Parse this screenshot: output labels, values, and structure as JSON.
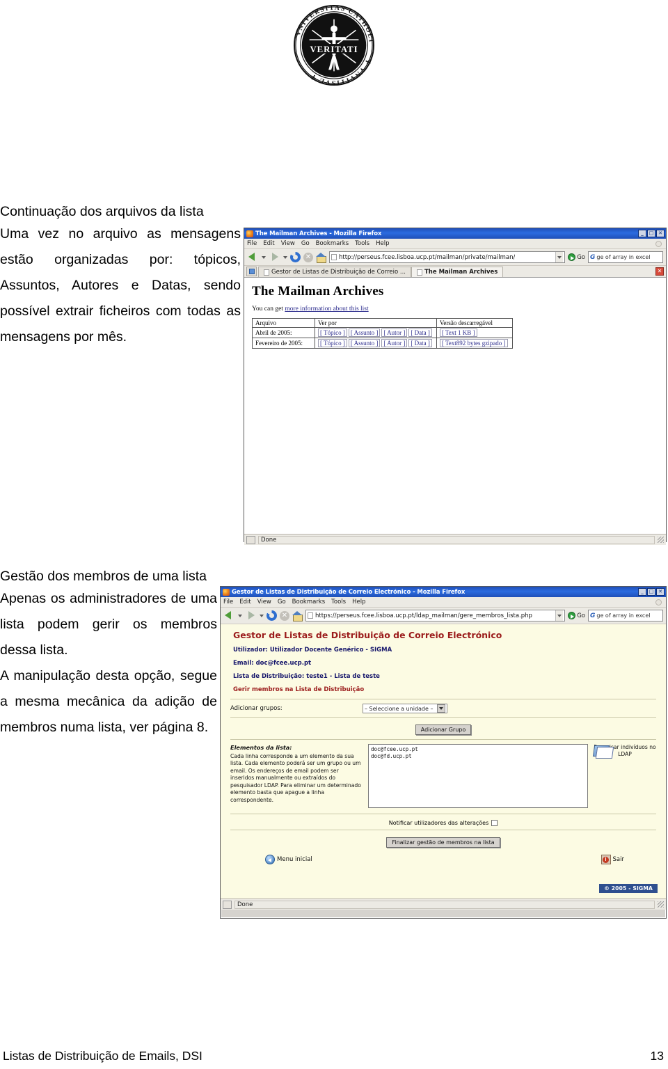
{
  "page": {
    "logo_alt": "university-seal",
    "seal_outer_text": "VNIVERSITAS CATHOLICA LVSITANA",
    "seal_inner_text": "VERITATI",
    "footer_left": "Listas de Distribuição de Emails, DSI",
    "footer_page_number": "13"
  },
  "section1": {
    "heading": "Continuação dos arquivos da lista",
    "paragraph": "Uma vez no arquivo as mensagens estão organizadas por: tópicos, Assuntos, Autores e Datas, sendo possível extrair ficheiros com todas as mensagens por mês."
  },
  "section2": {
    "heading": "Gestão dos membros de uma lista",
    "paragraph1": "Apenas os administradores de uma lista podem gerir os membros dessa lista.",
    "paragraph2": "A manipulação desta opção, segue a mesma mecânica da adição de membros numa lista, ver página 8."
  },
  "window1": {
    "title": "The Mailman Archives - Mozilla Firefox",
    "window_buttons": [
      "_",
      "□",
      "✕"
    ],
    "menus": [
      "File",
      "Edit",
      "View",
      "Go",
      "Bookmarks",
      "Tools",
      "Help"
    ],
    "url": "http://perseus.fcee.lisboa.ucp.pt/mailman/private/mailman/",
    "go_label": "Go",
    "search_placeholder": "ge of array in excel",
    "search_engine_glyph": "G",
    "tabs": [
      {
        "label": "Gestor de Listas de Distribuição de Correio ...",
        "active": false
      },
      {
        "label": "The Mailman Archives",
        "active": true
      }
    ],
    "page": {
      "title": "The Mailman Archives",
      "info_prefix": "You can get ",
      "info_link": "more information about this list",
      "table": {
        "headers": [
          "Arquivo",
          "Ver por",
          "Versão descarregável"
        ],
        "rows": [
          {
            "arquivo": "Abril de 2005:",
            "views": [
              "[ Tópico ]",
              "[ Assunto ]",
              "[ Autor ]",
              "[ Data ]"
            ],
            "download": "[ Text 1 KB ]"
          },
          {
            "arquivo": "Fevereiro de 2005:",
            "views": [
              "[ Tópico ]",
              "[ Assunto ]",
              "[ Autor ]",
              "[ Data ]"
            ],
            "download": "[ Text892 bytes gzipado ]"
          }
        ]
      }
    },
    "status": "Done"
  },
  "window2": {
    "title": "Gestor de Listas de Distribuição de Correio Electrónico - Mozilla Firefox",
    "window_buttons": [
      "_",
      "□",
      "✕"
    ],
    "menus": [
      "File",
      "Edit",
      "View",
      "Go",
      "Bookmarks",
      "Tools",
      "Help"
    ],
    "url": "https://perseus.fcee.lisboa.ucp.pt/ldap_mailman/gere_membros_lista.php",
    "go_label": "Go",
    "search_placeholder": "ge of array in excel",
    "search_engine_glyph": "G",
    "page": {
      "app_title": "Gestor de Listas de Distribuição de Correio Electrónico",
      "user_line": "Utilizador: Utilizador Docente Genérico - SIGMA",
      "email_line": "Email: doc@fcee.ucp.pt",
      "list_line": "Lista de Distribuição: teste1 - Lista de teste",
      "section_title": "Gerir membros na Lista de Distribuição",
      "add_groups_label": "Adicionar grupos:",
      "unit_select_value": "– Seleccione a unidade –",
      "add_group_button": "Adicionar Grupo",
      "help_title": "Elementos da lista:",
      "help_text": "Cada linha corresponde a um elemento da sua lista. Cada elemento poderá ser um grupo ou um email. Os endereços de email podem ser inseridos manualmente ou extraídos do pesquisador LDAP. Para eliminar um determinado elemento basta que apague a linha correspondente.",
      "members_textarea": "doc@fcee.ucp.pt\ndoc@fd.ucp.pt",
      "ldap_label": "Pesquisar indivíduos no LDAP",
      "notify_label": "Notificar utilizadores das alterações",
      "notify_checked": false,
      "finish_button": "Finalizar gestão de membros na lista",
      "home_button": "Menu inicial",
      "exit_button": "Sair",
      "copyright": "© 2005 - SIGMA"
    },
    "status": "Done"
  },
  "colors": {
    "titlebar_blue": "#1f4fb8",
    "page_cream": "#fcfbe3",
    "sigma_red": "#9b1b1b",
    "sigma_navy": "#16166b",
    "copyright_navy": "#2f4f8f"
  }
}
